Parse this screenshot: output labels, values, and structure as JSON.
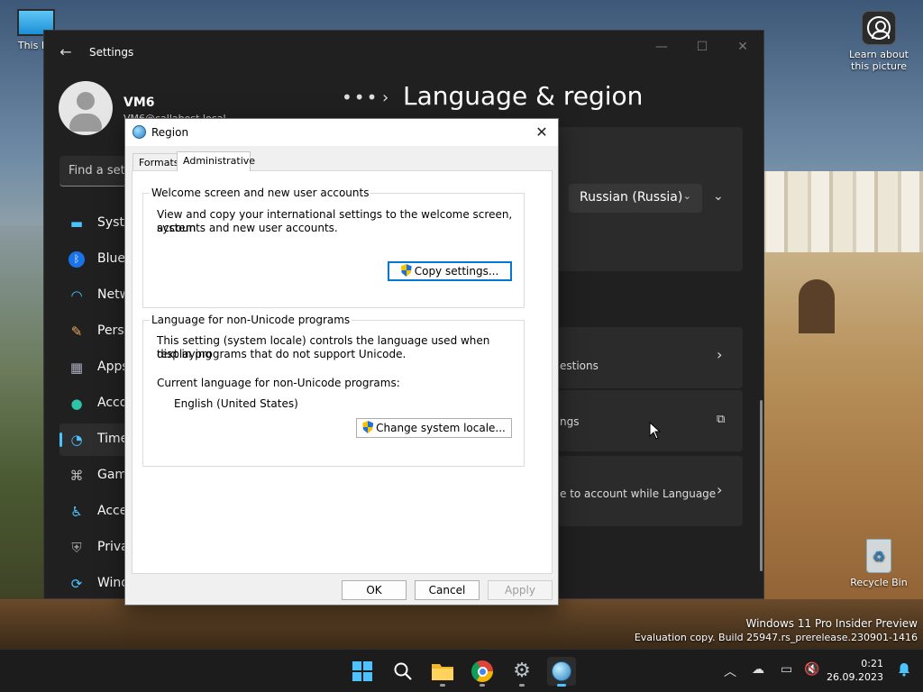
{
  "desktop": {
    "this_pc_label": "This PC",
    "learn_label_1": "Learn about",
    "learn_label_2": "this picture",
    "recycle_label": "Recycle Bin",
    "watermark_1": "Windows 11 Pro Insider Preview",
    "watermark_2": "Evaluation copy. Build 25947.rs_prerelease.230901-1416"
  },
  "settings": {
    "app_title": "Settings",
    "user_name": "VM6",
    "user_email": "VM6@callahost.local",
    "search_placeholder": "Find a setting",
    "nav": [
      {
        "label": "System",
        "icon": "monitor-icon"
      },
      {
        "label": "Bluetooth & devices",
        "icon": "bluetooth-icon"
      },
      {
        "label": "Network & internet",
        "icon": "wifi-icon"
      },
      {
        "label": "Personalization",
        "icon": "brush-icon"
      },
      {
        "label": "Apps",
        "icon": "apps-icon"
      },
      {
        "label": "Accounts",
        "icon": "person-icon"
      },
      {
        "label": "Time & language",
        "icon": "clock-globe-icon",
        "selected": true
      },
      {
        "label": "Gaming",
        "icon": "gamepad-icon"
      },
      {
        "label": "Accessibility",
        "icon": "accessibility-icon"
      },
      {
        "label": "Privacy & security",
        "icon": "shield-icon"
      },
      {
        "label": "Windows Update",
        "icon": "update-icon"
      }
    ],
    "breadcrumb_dots": "•••",
    "page_title": "Language & region",
    "display_language": "Russian (Russia)",
    "card_suggestions": "estions",
    "card_settings": "ngs",
    "card_account": "e to account while Language"
  },
  "dialog": {
    "title": "Region",
    "tabs": [
      "Formats",
      "Administrative"
    ],
    "active_tab": "Administrative",
    "welcome_group": {
      "legend": "Welcome screen and new user accounts",
      "text_1": "View and copy your international settings to the welcome screen, system",
      "text_2": "accounts and new user accounts.",
      "button": "Copy settings..."
    },
    "unicode_group": {
      "legend": "Language for non-Unicode programs",
      "text_1": "This setting (system locale) controls the language used when displaying",
      "text_2": "text in programs that do not support Unicode.",
      "current_label": "Current language for non-Unicode programs:",
      "current_value": "English (United States)",
      "button": "Change system locale..."
    },
    "ok": "OK",
    "cancel": "Cancel",
    "apply": "Apply"
  },
  "taskbar": {
    "time": "0:21",
    "date": "26.09.2023",
    "apps": [
      "start-icon",
      "search-icon",
      "file-explorer-icon",
      "chrome-icon",
      "settings-icon",
      "region-icon"
    ]
  }
}
